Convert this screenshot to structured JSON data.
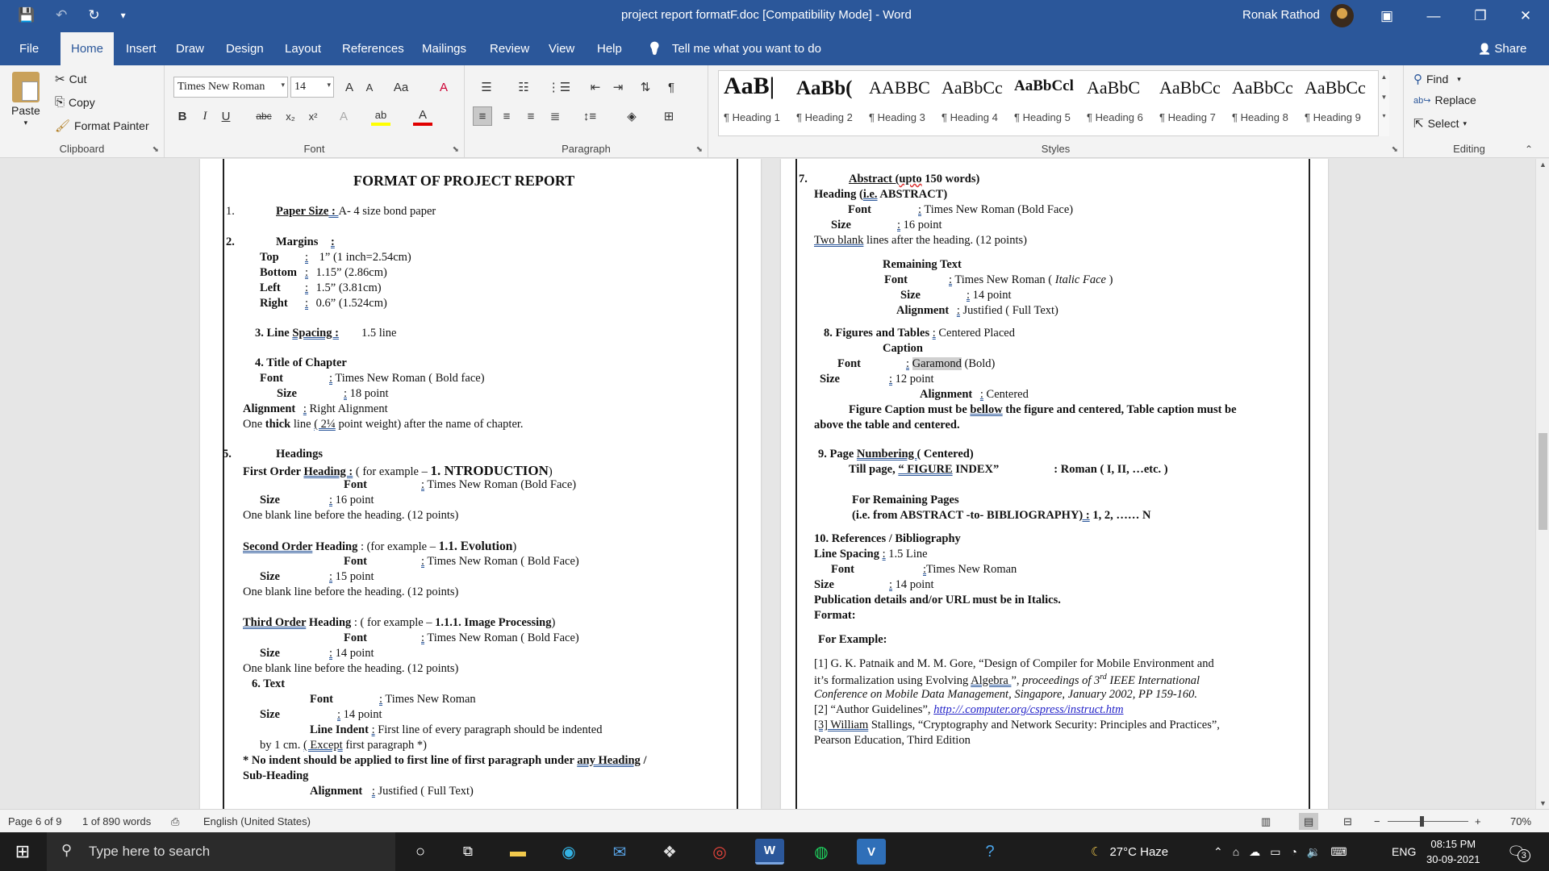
{
  "titlebar": {
    "qat": {
      "save_icon": "💾",
      "undo_icon": "↶",
      "redo_icon": "↻",
      "customize_icon": "▾"
    },
    "title": "project report formatF.doc [Compatibility Mode]  -  Word",
    "user": "Ronak Rathod",
    "ribbon_display_icon": "▣",
    "minimize": "—",
    "restore": "❐",
    "close": "✕"
  },
  "tabs": [
    {
      "label": "File"
    },
    {
      "label": "Home"
    },
    {
      "label": "Insert"
    },
    {
      "label": "Draw"
    },
    {
      "label": "Design"
    },
    {
      "label": "Layout"
    },
    {
      "label": "References"
    },
    {
      "label": "Mailings"
    },
    {
      "label": "Review"
    },
    {
      "label": "View"
    },
    {
      "label": "Help"
    }
  ],
  "tellme": {
    "icon": "💡",
    "text": "Tell me what you want to do"
  },
  "share": {
    "icon": "👤",
    "label": "Share"
  },
  "clipboard": {
    "paste_label": "Paste",
    "cut_label": "Cut",
    "copy_label": "Copy",
    "format_painter_label": "Format Painter",
    "group_label": "Clipboard"
  },
  "font": {
    "name": "Times New Roman",
    "size": "14",
    "grow": "A",
    "shrink": "A",
    "change_case": "Aa",
    "clear": "A",
    "bold": "B",
    "italic": "I",
    "underline": "U",
    "strike": "abc",
    "subscript": "x₂",
    "superscript": "x²",
    "effects": "A",
    "highlight": "ab",
    "color": "A",
    "group_label": "Font"
  },
  "paragraph": {
    "group_label": "Paragraph",
    "pilcrow": "¶"
  },
  "styles": {
    "group_label": "Styles",
    "items": [
      {
        "preview": "AaB|",
        "name": "¶ Heading 1"
      },
      {
        "preview": "AaBb(",
        "name": "¶ Heading 2"
      },
      {
        "preview": "AABBC",
        "name": "¶ Heading 3"
      },
      {
        "preview": "AaBbCc",
        "name": "¶ Heading 4"
      },
      {
        "preview": "AaBbCcl",
        "name": "¶ Heading 5"
      },
      {
        "preview": "AaBbC",
        "name": "¶ Heading 6"
      },
      {
        "preview": "AaBbCc",
        "name": "¶ Heading 7"
      },
      {
        "preview": "AaBbCc",
        "name": "¶ Heading 8"
      },
      {
        "preview": "AaBbCc",
        "name": "¶ Heading 9"
      }
    ]
  },
  "editing": {
    "find": "Find",
    "replace": "Replace",
    "select": "Select",
    "group_label": "Editing"
  },
  "page_left": {
    "title": "FORMAT OF PROJECT REPORT",
    "l1_num": "1.",
    "l1_label": "Paper Size",
    "l1_colon": " : ",
    "l1_val": "A- 4  size bond paper",
    "l2_num": "2.",
    "l2_label": "Margins",
    "l2_colon": ":",
    "top_l": "Top",
    "top_v": "1”    (1 inch=2.54cm)",
    "bottom_l": "Bottom",
    "bottom_v": "1.15” (2.86cm)",
    "left_l": "Left",
    "left_v": "1.5”   (3.81cm)",
    "right_l": "Right",
    "right_v": "0.6”  (1.524cm)",
    "ls_pre": "3.  Line ",
    "ls_u": "Spacing :",
    "ls_val": "1.5 line",
    "toc": "4. Title of Chapter",
    "toc_font_l": "Font",
    "toc_font_v": "Times New Roman ( Bold face)",
    "toc_size_l": "Size",
    "toc_size_v": "18  point",
    "toc_align_l": "Alignment",
    "toc_align_v": "Right Alignment",
    "toc_line_a": "One ",
    "toc_line_b": "thick",
    "toc_line_c": " line ",
    "toc_line_d": "( 2¼",
    "toc_line_e": " point weight) after the name of chapter.",
    "h5_num": "5.",
    "h5": "Headings",
    "fo_a": "First Order ",
    "fo_b": "Heading :",
    "fo_c": "  ( for example – ",
    "fo_d": "1. NTRODUCTION",
    "fo_e": ")",
    "fo_font_l": "Font",
    "fo_font_v": "Times New Roman  (Bold Face)",
    "fo_size_l": "Size",
    "fo_size_v": "16  point",
    "fo_blank": "One blank line before the heading. (12 points)",
    "so_a": "Second  Order",
    "so_b": " Heading",
    "so_c": " : (for example – ",
    "so_d": "1.1.  Evolution",
    "so_e": ")",
    "so_font_l": "Font",
    "so_font_v": "Times New Roman ( Bold Face)",
    "so_size_l": "Size",
    "so_size_v": "15  point",
    "so_blank": "One blank line before the heading. (12 points)",
    "to_a": "Third  Order",
    "to_b": " Heading",
    "to_c": " : ( for example – ",
    "to_d": "1.1.1. Image Processing",
    "to_e": ")",
    "to_font_l": "Font",
    "to_font_v": "Times New Roman ( Bold Face)",
    "to_size_l": "Size",
    "to_size_v": "14  point",
    "to_blank": "One blank line before the heading. (12 points)",
    "tx": "6. Text",
    "tx_font_l": "Font",
    "tx_font_v": "Times New Roman",
    "tx_size_l": "Size",
    "tx_size_v": "14  point",
    "tx_indent_l": "Line Indent",
    "tx_indent_v": "First line of every paragraph should be indented",
    "tx_by": "by 1 cm. ",
    "tx_except": "( Except",
    "tx_first": " first paragraph  *)",
    "note_a": "* No indent should be applied to first line of first paragraph under ",
    "note_b": "any  Heading",
    "note_c": " /",
    "note2": "Sub-Heading",
    "tx_align_l": "Alignment",
    "tx_align_v": "Justified ( Full Text)"
  },
  "page_right": {
    "n7": "7.",
    "abs_a": "Abstract  (",
    "abs_b": "upto",
    "abs_c": " 150 words)",
    "abs_head_a": "Heading (",
    "abs_head_b": "i.e.",
    "abs_head_c": " ABSTRACT)",
    "abs_font_l": "Font",
    "abs_font_v": "Times New Roman (Bold Face)",
    "abs_size_l": "Size",
    "abs_size_v": "16  point",
    "abs_blank_a": "Two  blank",
    "abs_blank_b": " lines  after the heading. (12 points)",
    "rem": "Remaining Text",
    "rem_font_l": "Font",
    "rem_font_v1": "Times New Roman ( ",
    "rem_font_v2": "Italic Face",
    "rem_font_v3": " )",
    "rem_size_l": "Size",
    "rem_size_v": "14  point",
    "rem_align_l": "Alignment",
    "rem_align_v": "Justified       ( Full Text)",
    "fig": "8.   Figures and Tables",
    "fig_v": "Centered Placed",
    "cap": "Caption",
    "cap_font_l": "Font",
    "cap_font_v": "Garamond",
    "cap_font_b": " (Bold)",
    "cap_size_l": "Size",
    "cap_size_v": "12  point",
    "cap_align_l": "Alignment",
    "cap_align_v": "Centered",
    "cap_note_a": "Figure Caption must be ",
    "cap_note_b": "bellow",
    "cap_note_c": " the figure and centered, Table caption must be",
    "cap_note2": "above the table and centered.",
    "pn_a": "9.  Page ",
    "pn_b": "Numbering   ",
    "pn_c": "( Centered)",
    "pn_till_a": "Till page, ",
    "pn_till_b": "“ FIGURE",
    "pn_till_c": " INDEX”",
    "pn_till_d": ": Roman  ( I, II, …etc. )",
    "pn_rem": "For Remaining Pages",
    "pn_rem2_a": "(i.e. from ABSTRACT -to- BIBLIOGRAPHY",
    "pn_rem2_b": ") :",
    "pn_rem2_c": " 1, 2, …… N",
    "ref": "10.  References / Bibliography",
    "ref_ls_a": "Line Spacing ",
    "ref_ls_b": ":",
    "ref_ls_c": " 1.5 Line",
    "ref_font_l": "Font",
    "ref_font_v": "Times New Roman",
    "ref_size_l": "Size",
    "ref_size_v": "14  point",
    "ref_pub": "Publication details and/or URL must be in Italics.",
    "ref_fmt": "Format:",
    "ref_ex": "For Example:",
    "r1_a": "[1]      G. K. Patnaik and M. M. Gore, “Design of Compiler for Mobile Environment and",
    "r1_b1": "it’s  formalization  using  Evolving  ",
    "r1_b2": "Algebra ",
    "r1_b3": "”,  ",
    "r1_b4": "proceedings  of  3",
    "r1_sup": "rd",
    "r1_b5": "  IEEE  International",
    "r1_c": "Conference on Mobile Data Management, Singapore, January 2002, PP 159-160.",
    "r2_a": "[2]      “Author Guidelines”, ",
    "r2_b": "http://.computer.org/cspress/instruct.htm",
    "r3_a": "[3]",
    "r3_b": " William",
    "r3_c": " Stallings, “Cryptography and Network Security: Principles and Practices”,",
    "r3_d": "Pearson Education, Third Edition"
  },
  "colon": ":",
  "statusbar": {
    "page": "Page 6 of 9",
    "words": "1 of 890 words",
    "language": "English (United States)",
    "zoom": "70%"
  },
  "taskbar": {
    "search_placeholder": "Type here to search",
    "weather": "27°C  Haze",
    "lang": "ENG",
    "time": "08:15 PM",
    "date": "30-09-2021",
    "notif_count": "3"
  },
  "colors": {
    "word_blue": "#2b579a",
    "taskbar": "#1c1c1c"
  }
}
